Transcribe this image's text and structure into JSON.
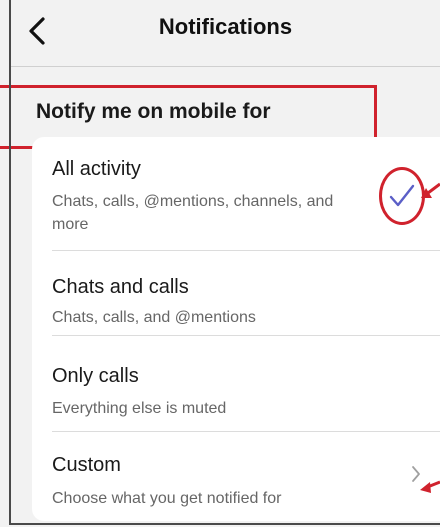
{
  "header": {
    "title": "Notifications"
  },
  "section": {
    "label": "Notify me on mobile for"
  },
  "options": [
    {
      "title": "All activity",
      "subtitle": "Chats, calls, @mentions, channels, and more",
      "selected": true
    },
    {
      "title": "Chats and calls",
      "subtitle": "Chats, calls, and @mentions",
      "selected": false
    },
    {
      "title": "Only calls",
      "subtitle": "Everything else is muted",
      "selected": false
    },
    {
      "title": "Custom",
      "subtitle": "Choose what you get notified for",
      "selected": false
    }
  ],
  "colors": {
    "accent": "#5b5fc7",
    "annotation": "#d0222d",
    "background": "#f2f2f2",
    "card": "#ffffff"
  },
  "icons": {
    "back": "chevron-left-icon",
    "selected": "checkmark-icon",
    "more": "chevron-right-icon"
  }
}
